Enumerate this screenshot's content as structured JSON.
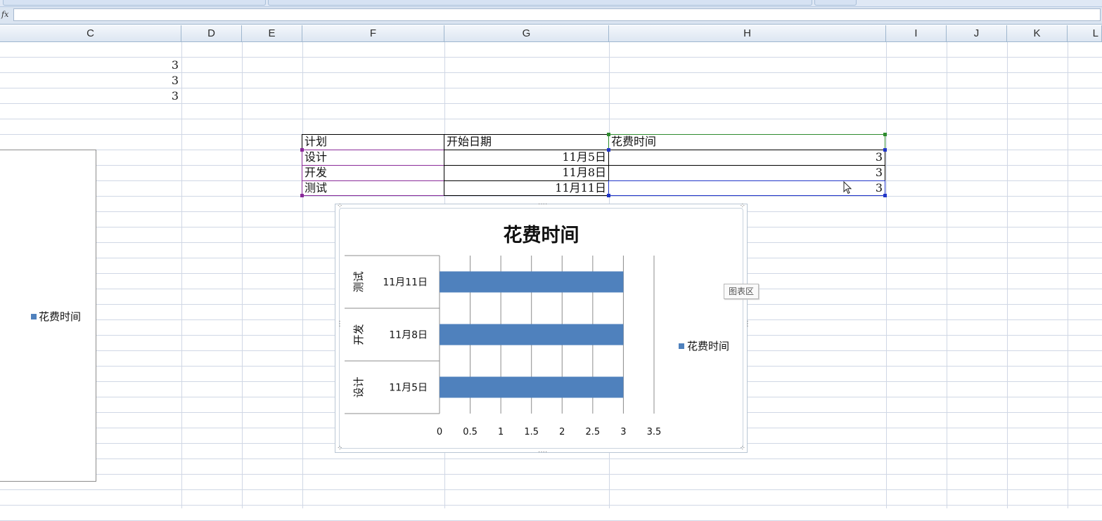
{
  "formula_bar": {
    "fx_label": "fx",
    "value": ""
  },
  "columns": [
    "C",
    "D",
    "E",
    "F",
    "G",
    "H",
    "I",
    "J",
    "K",
    "L"
  ],
  "column_c_values": [
    "3",
    "3",
    "3"
  ],
  "table": {
    "headers": [
      "计划",
      "开始日期",
      "花费时间"
    ],
    "rows": [
      {
        "plan": "设计",
        "start": "11月5日",
        "duration": "3"
      },
      {
        "plan": "开发",
        "start": "11月8日",
        "duration": "3"
      },
      {
        "plan": "测试",
        "start": "11月11日",
        "duration": "3"
      }
    ]
  },
  "left_chart": {
    "legend_label": "花费时间"
  },
  "tooltip": "图表区",
  "chart_data": {
    "type": "bar",
    "orientation": "horizontal",
    "title": "花费时间",
    "categories": [
      {
        "group": "设计",
        "label": "11月5日"
      },
      {
        "group": "开发",
        "label": "11月8日"
      },
      {
        "group": "测试",
        "label": "11月11日"
      }
    ],
    "series": [
      {
        "name": "花费时间",
        "values": [
          3,
          3,
          3
        ],
        "color": "#4f81bd"
      }
    ],
    "xlim": [
      0,
      3.5
    ],
    "xticks": [
      "0",
      "0.5",
      "1",
      "1.5",
      "2",
      "2.5",
      "3",
      "3.5"
    ],
    "grid": true,
    "legend": "right"
  }
}
